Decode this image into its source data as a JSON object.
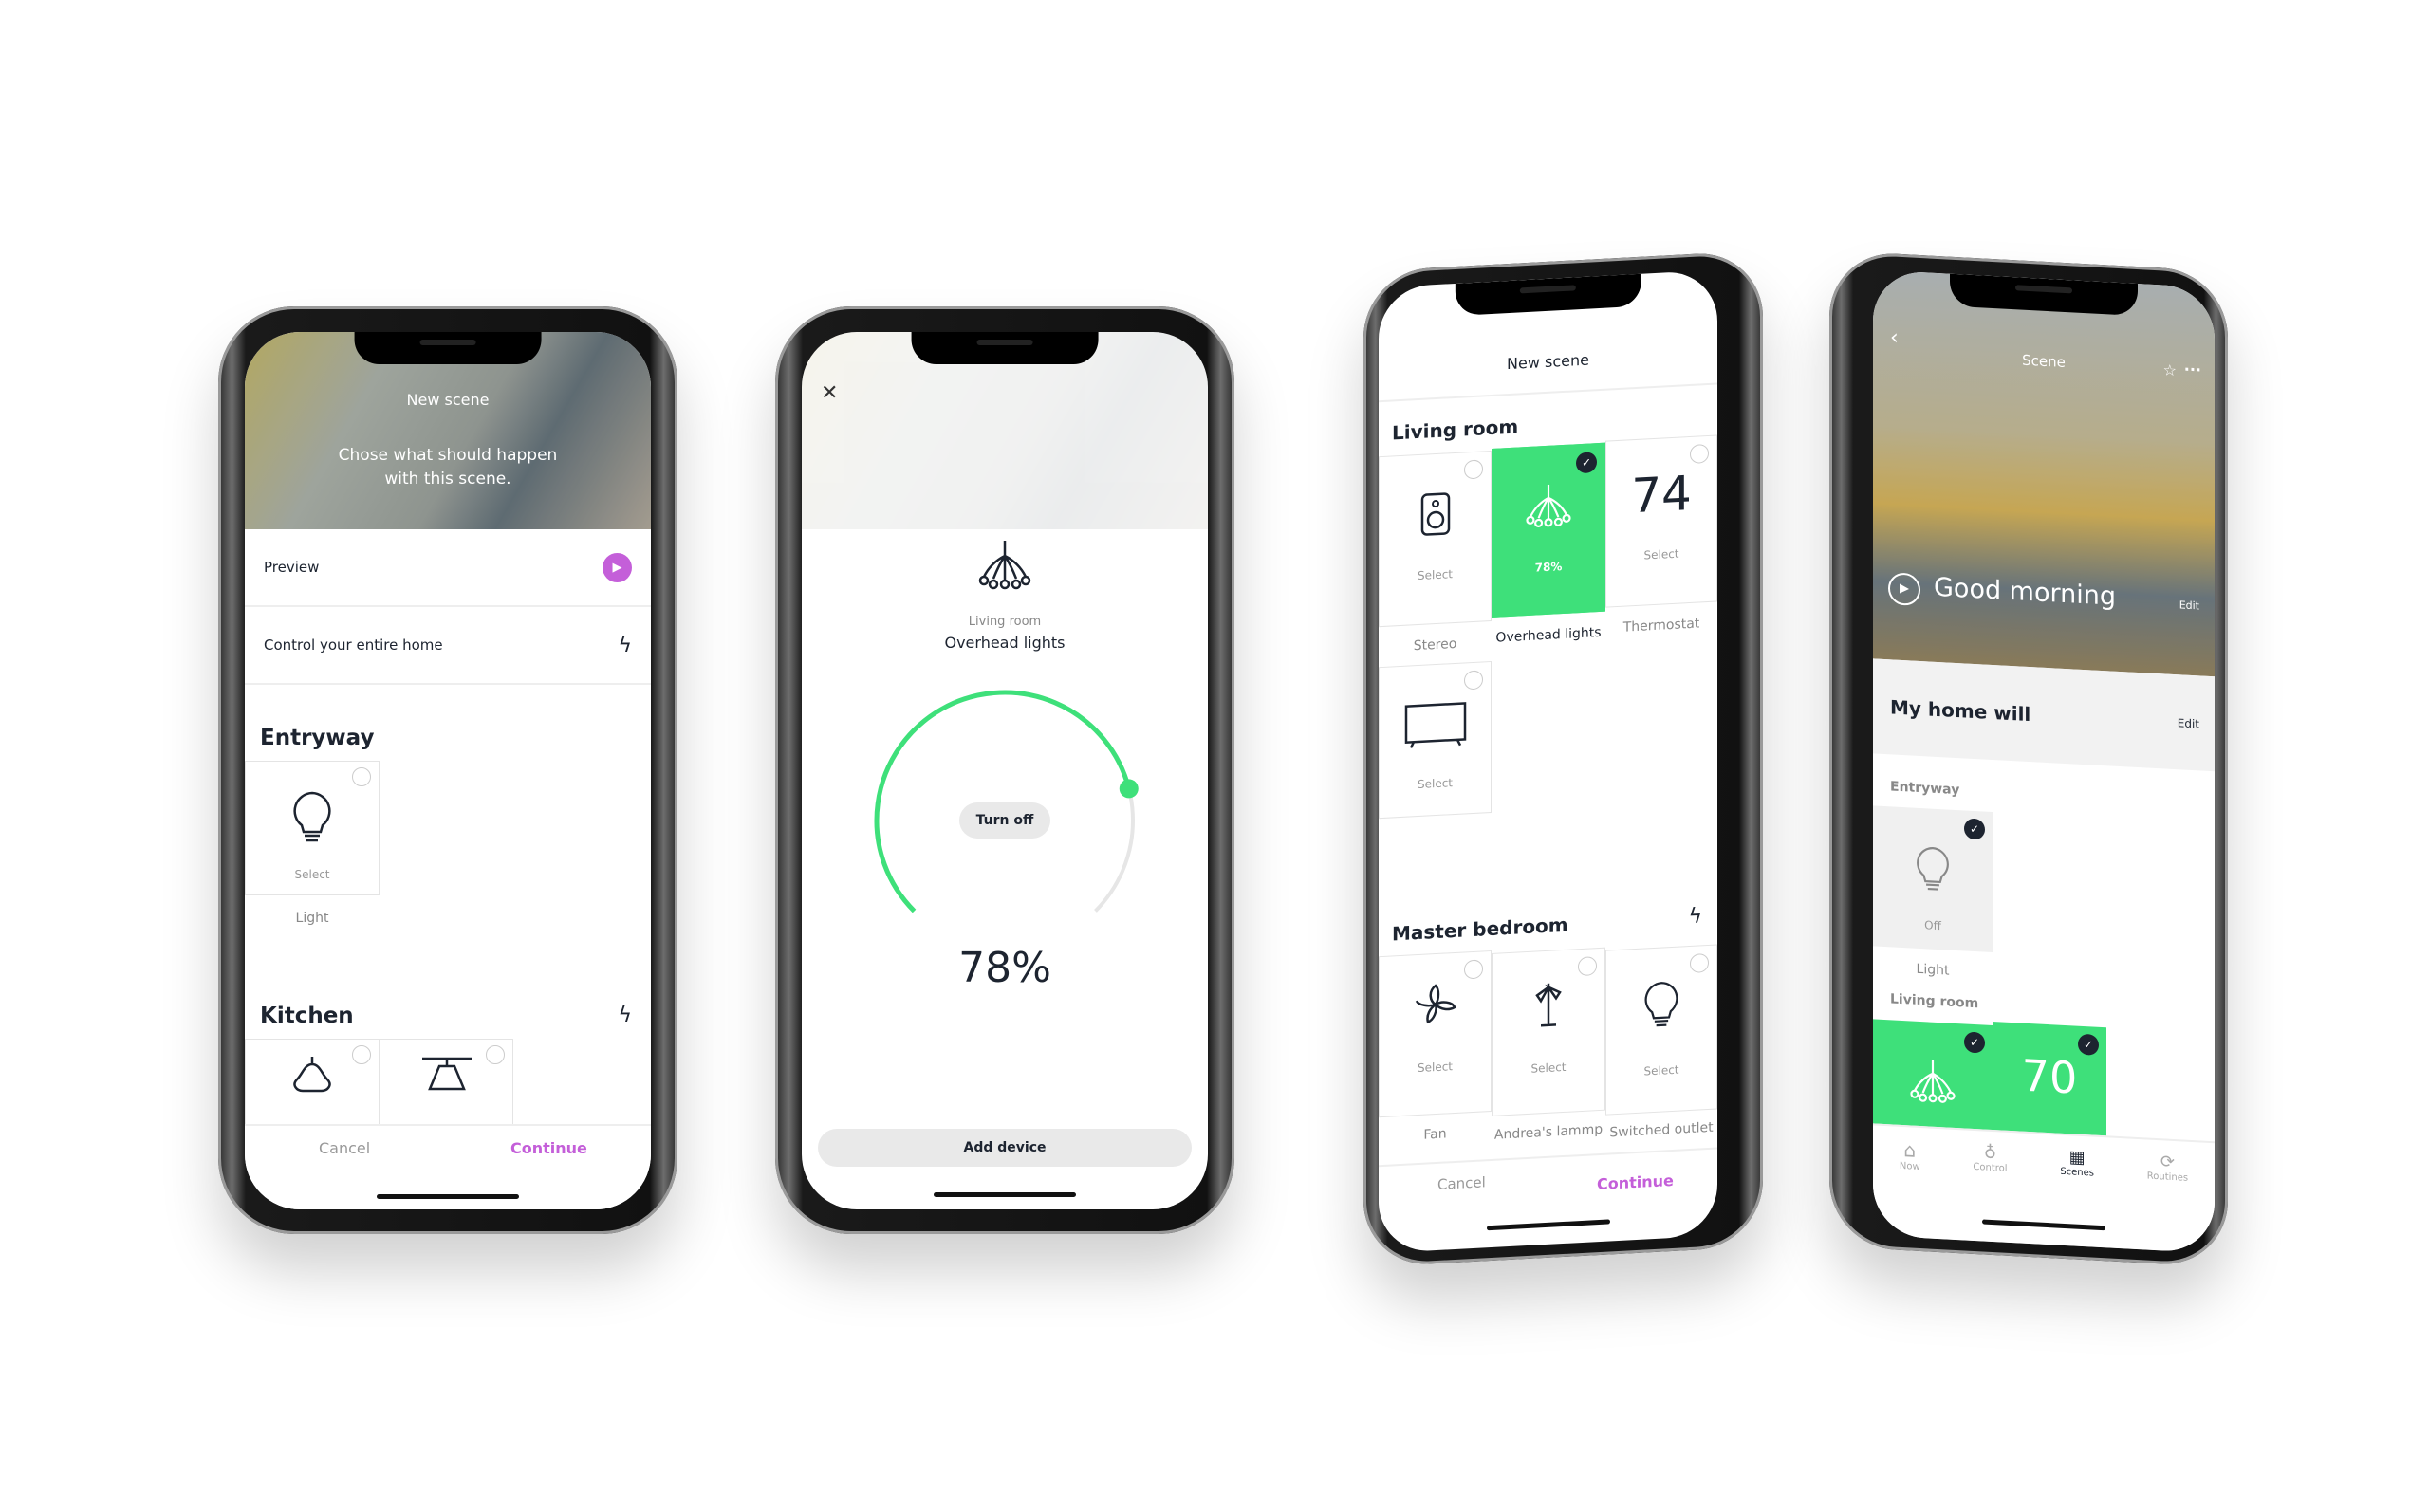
{
  "accent_colors": {
    "purple": "#c45fd9",
    "green": "#3ee07a",
    "dark": "#1d2430"
  },
  "phone1": {
    "header_title": "New scene",
    "header_subtitle": "Chose what should happen with this scene.",
    "preview_label": "Preview",
    "control_label": "Control your entire home",
    "sections": [
      {
        "title": "Entryway",
        "devices": [
          {
            "status": "Select",
            "name": "Light",
            "icon": "lightbulb-icon"
          }
        ]
      },
      {
        "title": "Kitchen",
        "devices": [
          {
            "icon": "pendant-lamp-icon"
          },
          {
            "icon": "ceiling-lamp-icon"
          }
        ]
      }
    ],
    "cancel": "Cancel",
    "continue": "Continue"
  },
  "phone2": {
    "room": "Living room",
    "device": "Overhead lights",
    "turn_off": "Turn off",
    "level": "78%",
    "level_value": 78,
    "add_device": "Add device"
  },
  "phone3": {
    "title": "New scene",
    "living_room": {
      "title": "Living room",
      "devices": [
        {
          "name": "Stereo",
          "status": "Select",
          "selected": false
        },
        {
          "name": "Overhead lights",
          "status": "78%",
          "selected": true
        },
        {
          "name": "Thermostat",
          "status": "Select",
          "value": "74",
          "selected": false
        },
        {
          "name": "",
          "status": "Select",
          "selected": false
        }
      ]
    },
    "master_bedroom": {
      "title": "Master bedroom",
      "devices": [
        {
          "name": "Fan",
          "status": "Select"
        },
        {
          "name": "Andrea's lammp",
          "status": "Select"
        },
        {
          "name": "Switched outlet",
          "status": "Select"
        }
      ]
    },
    "cancel": "Cancel",
    "continue": "Continue"
  },
  "phone4": {
    "title": "Scene",
    "scene_name": "Good morning",
    "edit": "Edit",
    "section_title": "My home will",
    "section_edit": "Edit",
    "entryway": {
      "title": "Entryway",
      "device": {
        "status": "Off",
        "name": "Light"
      }
    },
    "living_room": {
      "title": "Living room",
      "thermostat": "70"
    },
    "tabs": [
      {
        "label": "Now"
      },
      {
        "label": "Control"
      },
      {
        "label": "Scenes",
        "active": true
      },
      {
        "label": "Routines"
      }
    ]
  }
}
